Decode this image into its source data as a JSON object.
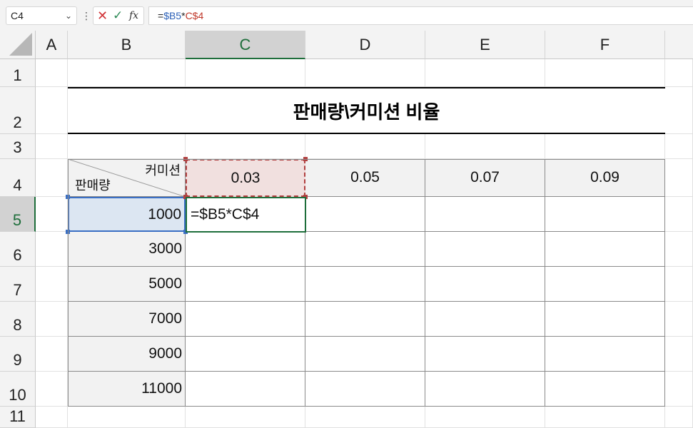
{
  "formula_bar": {
    "name_box": "C4",
    "name_box_arrow": "⌄",
    "dots": "⋮",
    "cancel": "✕",
    "enter": "✓",
    "fx": "fx",
    "formula_prefix": "=",
    "formula_ref1": "$B5",
    "formula_op": "*",
    "formula_ref2": "C$4"
  },
  "columns": [
    "A",
    "B",
    "C",
    "D",
    "E",
    "F"
  ],
  "rows": [
    "1",
    "2",
    "3",
    "4",
    "5",
    "6",
    "7",
    "8",
    "9",
    "10",
    "11"
  ],
  "active_column": "C",
  "active_row": "5",
  "sheet": {
    "title": "판매량\\커미션 비율",
    "diag_top": "커미션",
    "diag_bottom": "판매량",
    "rates": [
      "0.03",
      "0.05",
      "0.07",
      "0.09"
    ],
    "sales": [
      "1000",
      "3000",
      "5000",
      "7000",
      "9000",
      "11000"
    ],
    "edit_cell": "=$B5*C$4"
  },
  "colors": {
    "header_bg": "#f3f3f3",
    "active_header": "#1e6e3b",
    "ref_blue": "#2e62b8",
    "ref_red": "#c0392b"
  }
}
